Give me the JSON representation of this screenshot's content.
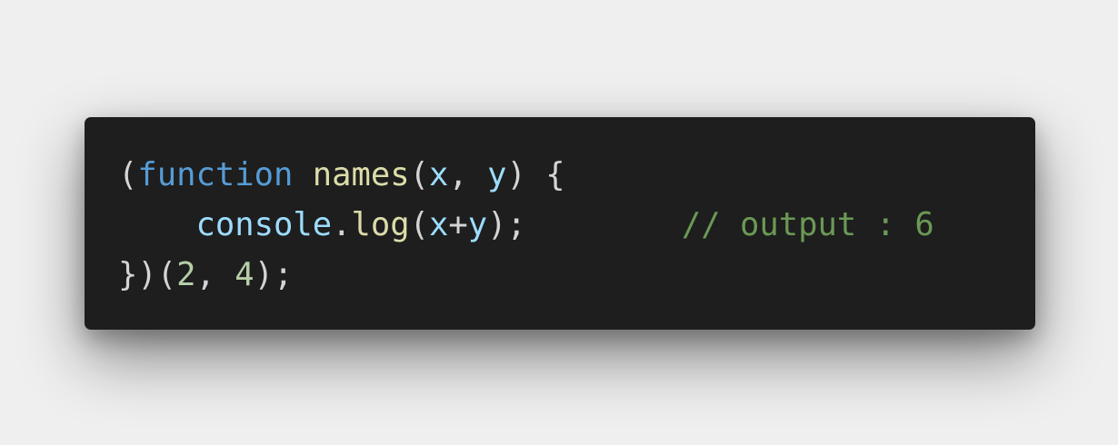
{
  "code": {
    "lines": [
      [
        {
          "t": "(",
          "c": "punct"
        },
        {
          "t": "function",
          "c": "kw"
        },
        {
          "t": " ",
          "c": "punct"
        },
        {
          "t": "names",
          "c": "fn"
        },
        {
          "t": "(",
          "c": "punct"
        },
        {
          "t": "x",
          "c": "var"
        },
        {
          "t": ", ",
          "c": "punct"
        },
        {
          "t": "y",
          "c": "var"
        },
        {
          "t": ") {",
          "c": "punct"
        }
      ],
      [
        {
          "t": "    ",
          "c": "punct"
        },
        {
          "t": "console",
          "c": "var"
        },
        {
          "t": ".",
          "c": "punct"
        },
        {
          "t": "log",
          "c": "fn"
        },
        {
          "t": "(",
          "c": "punct"
        },
        {
          "t": "x",
          "c": "var"
        },
        {
          "t": "+",
          "c": "punct"
        },
        {
          "t": "y",
          "c": "var"
        },
        {
          "t": ");",
          "c": "punct"
        },
        {
          "t": "        ",
          "c": "punct"
        },
        {
          "t": "// output : 6",
          "c": "cmt"
        }
      ],
      [
        {
          "t": "})(",
          "c": "punct"
        },
        {
          "t": "2",
          "c": "num"
        },
        {
          "t": ", ",
          "c": "punct"
        },
        {
          "t": "4",
          "c": "num"
        },
        {
          "t": ");",
          "c": "punct"
        }
      ]
    ]
  },
  "colors": {
    "background": "#efefef",
    "editor_background": "#1e1e1e",
    "punctuation": "#d4d4d4",
    "keyword": "#569cd6",
    "function": "#dcdcaa",
    "variable": "#9cdcfe",
    "number": "#b5cea8",
    "comment": "#6a9955"
  }
}
